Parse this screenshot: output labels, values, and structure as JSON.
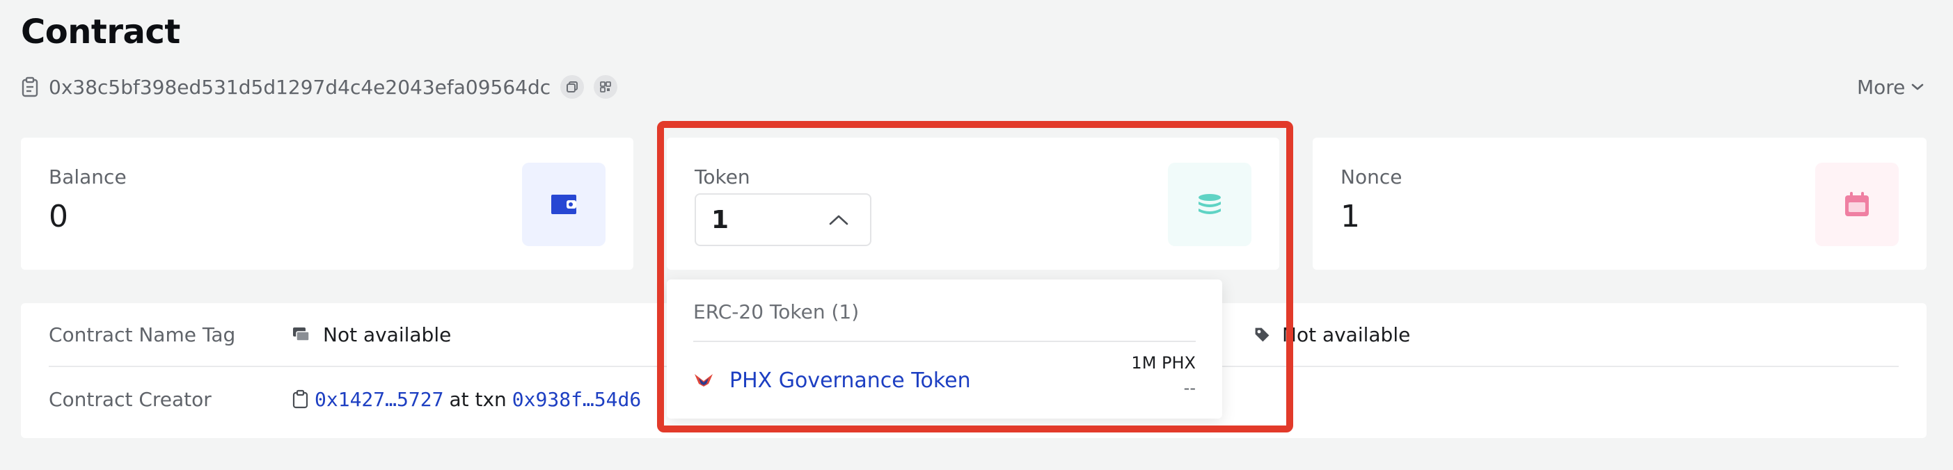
{
  "header": {
    "title": "Contract",
    "address": "0x38c5bf398ed531d5d1297d4c4e2043efa09564dc",
    "more_label": "More"
  },
  "cards": {
    "balance": {
      "label": "Balance",
      "value": "0",
      "icon": "wallet-icon",
      "accent": "#2747d3",
      "tile_bg": "#eef2ff"
    },
    "token": {
      "label": "Token",
      "selected": "1",
      "icon": "coins-stack-icon",
      "accent": "#5fd3c4",
      "tile_bg": "#f1fbfa"
    },
    "nonce": {
      "label": "Nonce",
      "value": "1",
      "icon": "calendar-icon",
      "accent": "#ef7fa2",
      "tile_bg": "#fff3f6"
    }
  },
  "details": {
    "name_tag_label": "Contract Name Tag",
    "name_tag_value": "Not available",
    "creator_label": "Contract Creator",
    "creator_address": "0x1427…5727",
    "creator_at": "at txn",
    "creator_txn": "0x938f…54d6",
    "right_value": "Not available"
  },
  "token_dropdown": {
    "header": "ERC-20 Token (1)",
    "items": [
      {
        "name": "PHX Governance Token",
        "amount": "1M PHX",
        "value": "--"
      }
    ]
  },
  "colors": {
    "link": "#1d3fc2",
    "highlight": "#e23a2a"
  }
}
